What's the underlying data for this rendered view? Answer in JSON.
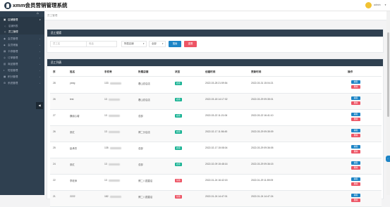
{
  "app": {
    "title": "xmm会员营销管理系统",
    "user_name": "admin"
  },
  "sidebar": {
    "items": [
      {
        "icon": "▣",
        "label": "店铺管理",
        "open": true
      },
      {
        "icon": "◉",
        "label": "会员管理"
      },
      {
        "icon": "◈",
        "label": "会员储值"
      },
      {
        "icon": "▤",
        "label": "卡券管理"
      },
      {
        "icon": "◎",
        "label": "订单管理"
      },
      {
        "icon": "▥",
        "label": "商品管理"
      },
      {
        "icon": "◐",
        "label": "短信管理"
      },
      {
        "icon": "▦",
        "label": "积分管理"
      },
      {
        "icon": "⚙",
        "label": "系统管理"
      }
    ],
    "sub_items": [
      {
        "label": "店铺列表"
      },
      {
        "label": "员工管理",
        "active": true
      }
    ]
  },
  "tabbar": {
    "active_tab": "员工管理"
  },
  "search": {
    "title": "员工搜索",
    "name_placeholder": "员工名",
    "phone_placeholder": "电话",
    "store_value": "所属店铺",
    "status_value": "全部",
    "search_label": "搜索",
    "reset_label": "重置"
  },
  "list": {
    "title": "员工列表",
    "headers": [
      "序",
      "姓名",
      "手机号",
      "所属店铺",
      "状态",
      "创建时间",
      "更新时间",
      "操作"
    ],
    "edit_label": "编辑",
    "delete_label": "删除",
    "rows": [
      {
        "id": "28",
        "name": "yang",
        "phone": "133",
        "store": "看山总店店",
        "status": "启用",
        "status_ok": true,
        "created": "2022-03-28 21:59:54",
        "updated": "2022-03-31 15:04:21"
      },
      {
        "id": "26",
        "name": "test",
        "phone": "13",
        "store": "看山总店店",
        "status": "启用",
        "status_ok": true,
        "created": "2022-03-18 14:17:32",
        "updated": "2022-03-29 09:35:01"
      },
      {
        "id": "27",
        "name": "魏淑心增",
        "phone": "13",
        "store": "总部",
        "status": "启用",
        "status_ok": true,
        "created": "2022-03-22 11:21:06",
        "updated": "2022-03-22 16:41:10"
      },
      {
        "id": "26",
        "name": "张红",
        "phone": "13",
        "store": "博二分店店",
        "status": "启用",
        "status_ok": true,
        "created": "2022-02-17 11:56:45",
        "updated": "2022-03-29 09:35:09"
      },
      {
        "id": "25",
        "name": "赵承芳",
        "phone": "135",
        "store": "总部",
        "status": "启用",
        "status_ok": true,
        "created": "2022-02-17 15:08:04",
        "updated": "2022-03-29 09:36:05"
      },
      {
        "id": "24",
        "name": "张红",
        "phone": "13",
        "store": "总部",
        "status": "启用",
        "status_ok": true,
        "created": "2022-02-09 15:48:16",
        "updated": "2022-03-29 09:36:15"
      },
      {
        "id": "22",
        "name": "李老师",
        "phone": "13",
        "store": "博二八国直店",
        "status": "禁用",
        "status_ok": false,
        "created": "2022-01-24 16:42:15",
        "updated": "2022-01-29 11:59:09"
      },
      {
        "id": "21",
        "name": "2222",
        "phone": "182",
        "store": "博二八国直店",
        "status": "禁用",
        "status_ok": false,
        "created": "2022-01-24 14:47:01",
        "updated": "2022-01-24 14:47:24"
      }
    ]
  }
}
